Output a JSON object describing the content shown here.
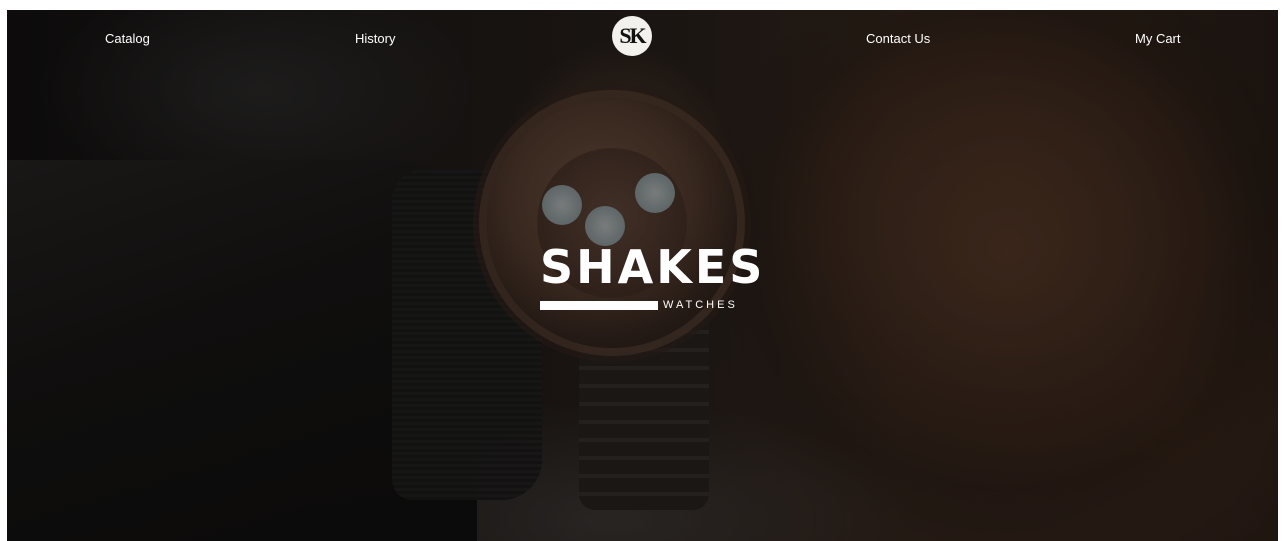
{
  "nav": {
    "catalog": "Catalog",
    "history": "History",
    "contact": "Contact Us",
    "cart": "My Cart",
    "logo_text": "SK"
  },
  "hero": {
    "title": "SHAKES",
    "subtitle": "WATCHES"
  }
}
